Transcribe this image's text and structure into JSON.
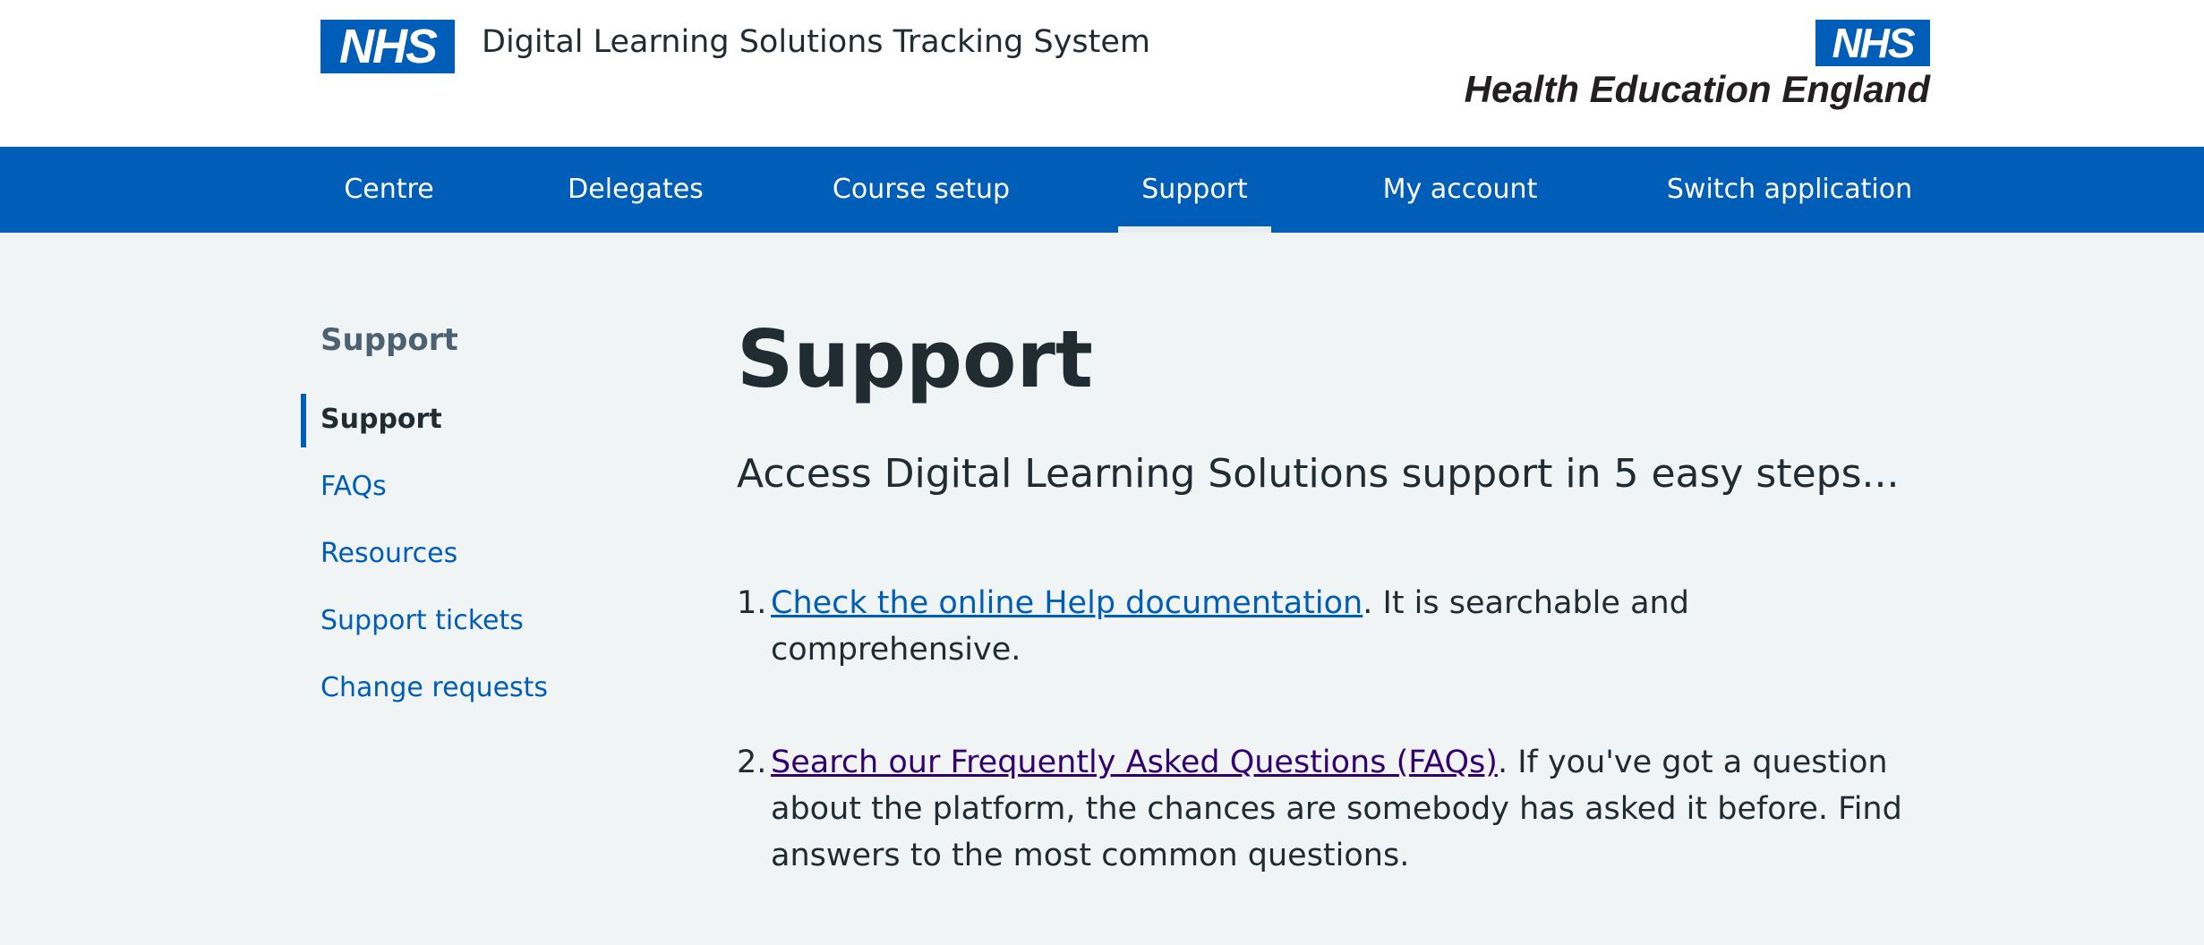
{
  "header": {
    "nhs_logo": "NHS",
    "service_name": "Digital Learning Solutions Tracking System",
    "partner_logo_mark": "NHS",
    "partner_logo_text": "Health Education England"
  },
  "nav": {
    "items": [
      {
        "label": "Centre"
      },
      {
        "label": "Delegates"
      },
      {
        "label": "Course setup"
      },
      {
        "label": "Support",
        "active": true
      },
      {
        "label": "My account"
      },
      {
        "label": "Switch application"
      }
    ]
  },
  "sidebar": {
    "title": "Support",
    "items": [
      {
        "label": "Support",
        "current": true
      },
      {
        "label": "FAQs"
      },
      {
        "label": "Resources"
      },
      {
        "label": "Support tickets"
      },
      {
        "label": "Change requests"
      }
    ]
  },
  "main": {
    "title": "Support",
    "lede": "Access Digital Learning Solutions support in 5 easy steps...",
    "steps": [
      {
        "number": "1.",
        "link": "Check the online Help documentation",
        "text": ". It is searchable and comprehensive."
      },
      {
        "number": "2.",
        "link": "Search our Frequently Asked Questions (FAQs)",
        "text": ". If you've got a question about the platform, the chances are somebody has asked it before. Find answers to the most common questions."
      }
    ]
  },
  "colors": {
    "nhs_blue": "#005eb8",
    "visited_link": "#330072",
    "text": "#212b32",
    "background": "#f0f4f5"
  }
}
